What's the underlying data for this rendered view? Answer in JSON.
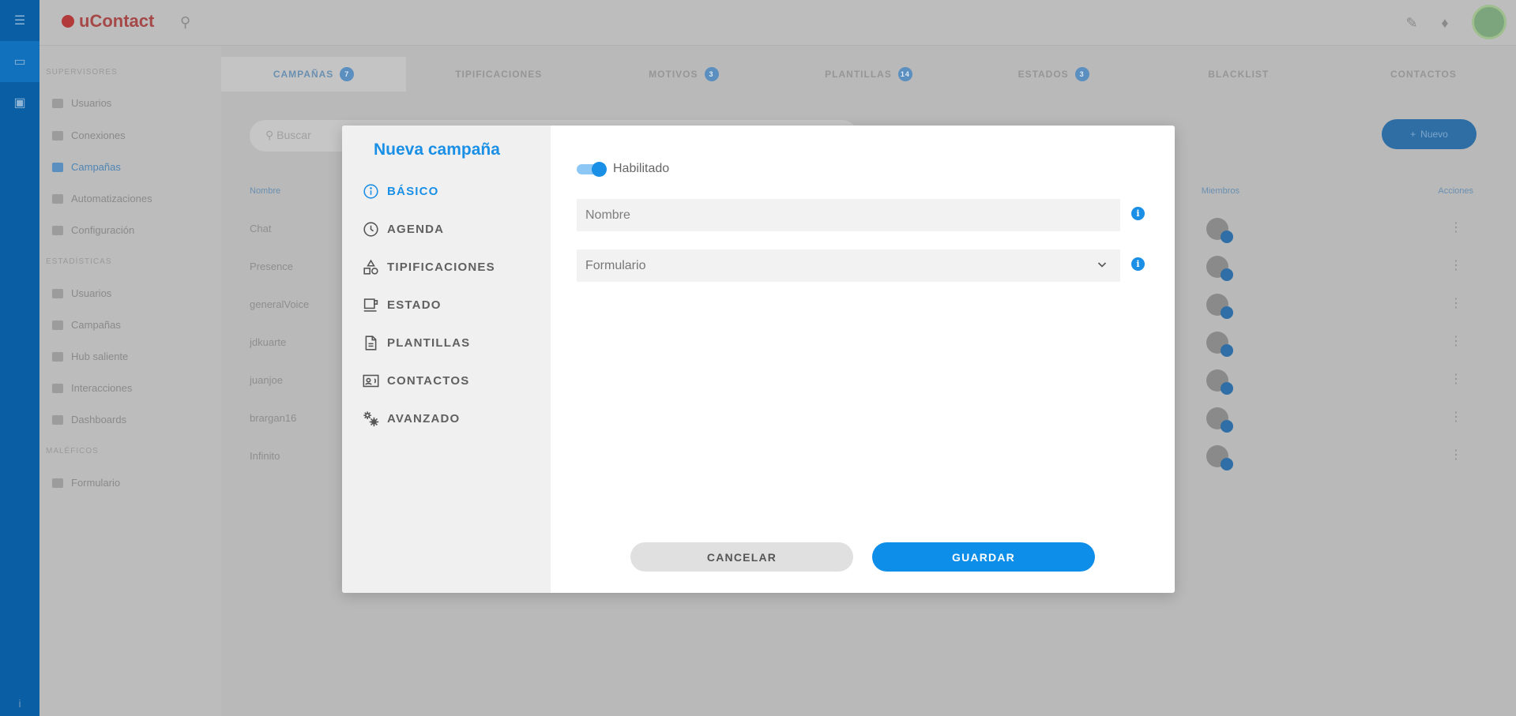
{
  "app": {
    "logo_text": "uContact",
    "tabs": [
      {
        "label": "CAMPAÑAS",
        "badge": "7"
      },
      {
        "label": "TIPIFICACIONES",
        "badge": ""
      },
      {
        "label": "MOTIVOS",
        "badge": "3"
      },
      {
        "label": "PLANTILLAS",
        "badge": "14"
      },
      {
        "label": "ESTADOS",
        "badge": "3"
      },
      {
        "label": "BLACKLIST",
        "badge": ""
      },
      {
        "label": "CONTACTOS",
        "badge": ""
      }
    ],
    "search_placeholder": "Buscar",
    "new_button": "Nuevo",
    "columns": {
      "name": "Nombre",
      "members": "Miembros",
      "actions": "Acciones"
    },
    "rows": [
      "Chat",
      "Presence",
      "generalVoice",
      "jdkuarte",
      "juanjoe",
      "brargan16",
      "Infinito"
    ],
    "sidebar": {
      "sections": [
        "SUPERVISORES",
        "ESTADÍSTICAS",
        "MALÉFICOS"
      ],
      "items_admin": [
        "Usuarios",
        "Conexiones",
        "Campañas",
        "Automatizaciones",
        "Configuración"
      ],
      "items_stats": [
        "Usuarios",
        "Campañas",
        "Hub saliente",
        "Interacciones",
        "Dashboards"
      ],
      "items_forms": [
        "Formulario"
      ]
    }
  },
  "modal": {
    "title": "Nueva campaña",
    "nav": [
      {
        "label": "BÁSICO",
        "icon": "info-circle-icon",
        "active": true
      },
      {
        "label": "AGENDA",
        "icon": "clock-icon",
        "active": false
      },
      {
        "label": "TIPIFICACIONES",
        "icon": "shapes-icon",
        "active": false
      },
      {
        "label": "ESTADO",
        "icon": "coffee-icon",
        "active": false
      },
      {
        "label": "PLANTILLAS",
        "icon": "document-icon",
        "active": false
      },
      {
        "label": "CONTACTOS",
        "icon": "contact-card-icon",
        "active": false
      },
      {
        "label": "AVANZADO",
        "icon": "gears-icon",
        "active": false
      }
    ],
    "enabled_label": "Habilitado",
    "enabled": true,
    "name_placeholder": "Nombre",
    "form_select_value": "Formulario",
    "cancel_label": "CANCELAR",
    "save_label": "GUARDAR",
    "accent_color": "#1a8fe6"
  }
}
